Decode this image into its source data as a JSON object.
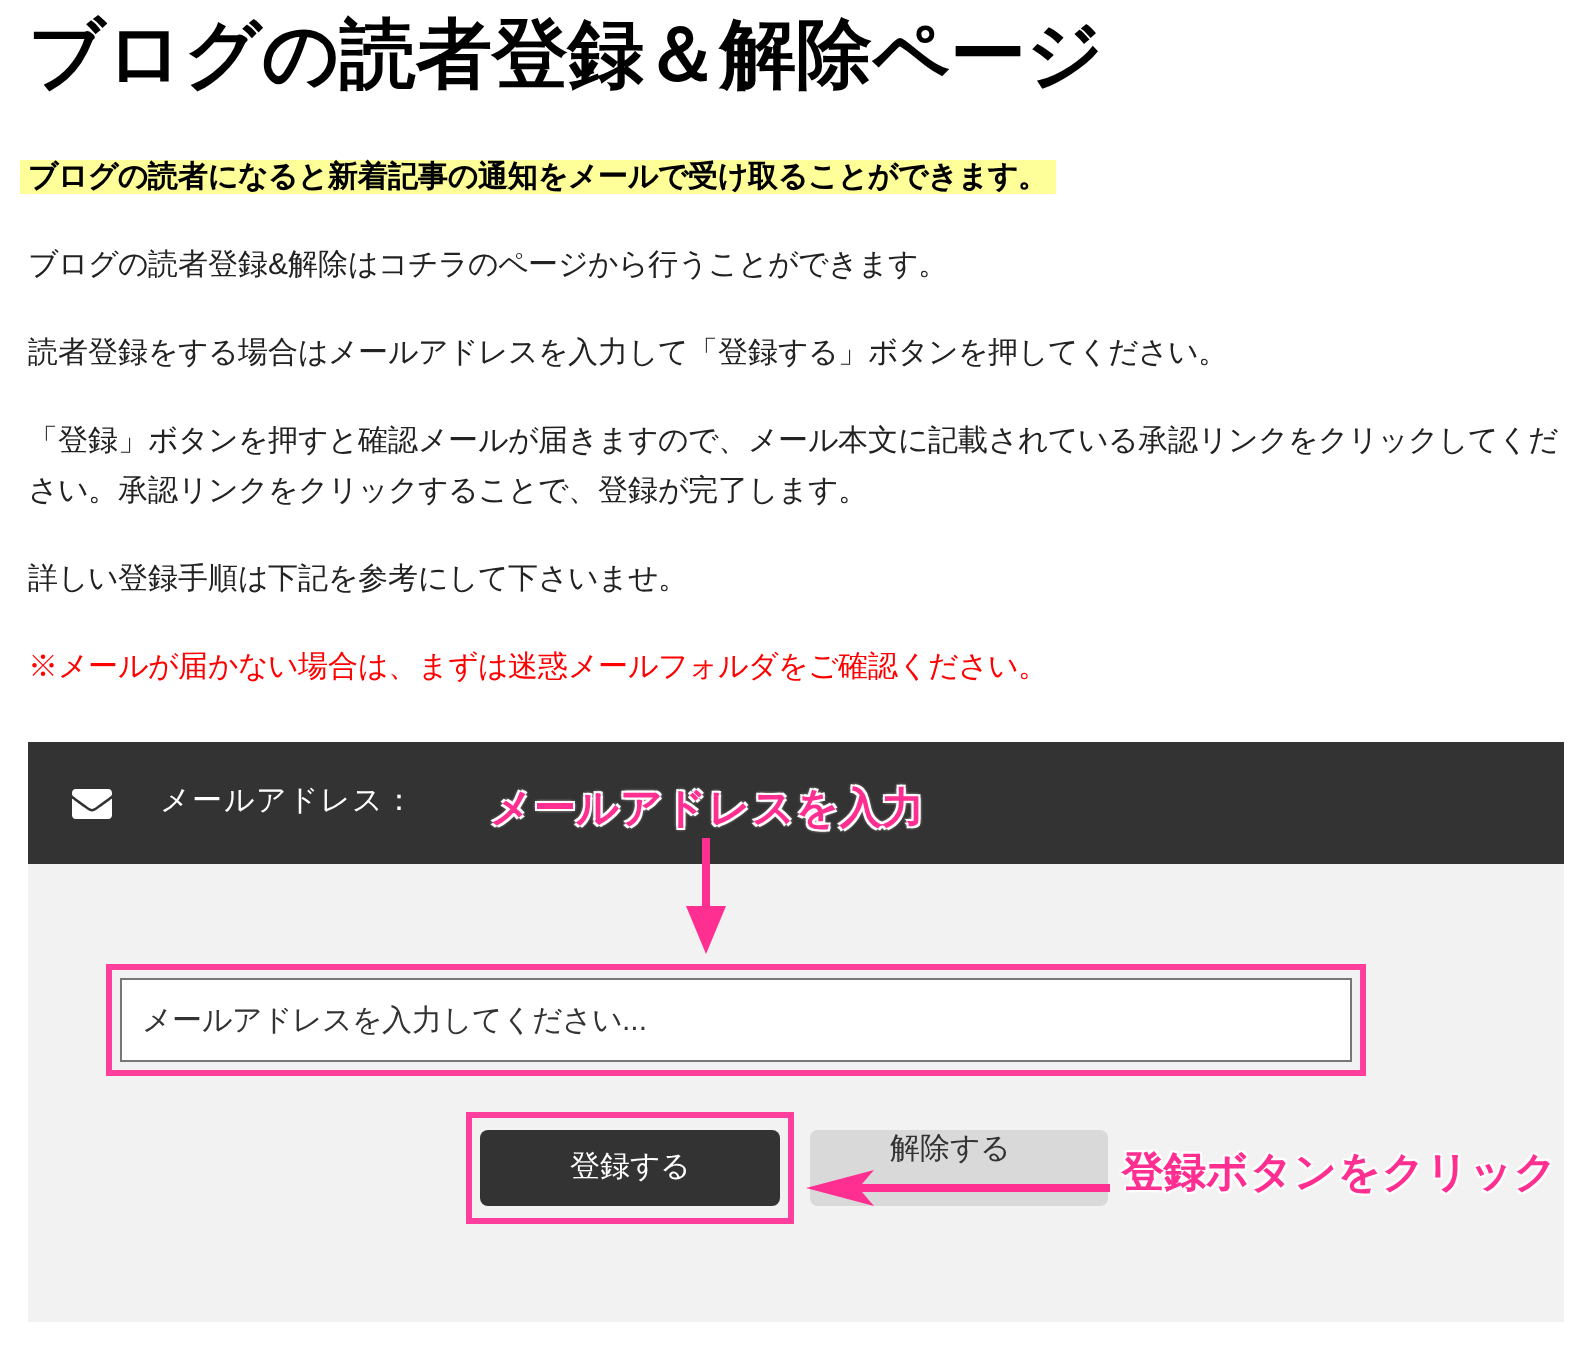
{
  "title": "ブログの読者登録＆解除ページ",
  "paragraphs": [
    {
      "kind": "highlight",
      "text": "ブログの読者になると新着記事の通知をメールで受け取ることができます。"
    },
    {
      "kind": "plain",
      "text": "ブログの読者登録&解除はコチラのページから行うことができます。"
    },
    {
      "kind": "plain",
      "text": "読者登録をする場合はメールアドレスを入力して「登録する」ボタンを押してください。"
    },
    {
      "kind": "plain",
      "text": "「登録」ボタンを押すと確認メールが届きますので、メール本文に記載されている承認リンクをクリックしてください。承認リンクをクリックすることで、登録が完了します。"
    },
    {
      "kind": "plain",
      "text": "詳しい登録手順は下記を参考にして下さいませ。"
    },
    {
      "kind": "warning",
      "text": "※メールが届かない場合は、まずは迷惑メールフォルダをご確認ください。"
    }
  ],
  "form": {
    "label": "メールアドレス：",
    "placeholder": "メールアドレスを入力してください...",
    "buttons": [
      {
        "kind": "primary",
        "label": "登録する"
      },
      {
        "kind": "secondary",
        "label": "解除する"
      }
    ]
  },
  "annotations": [
    {
      "kind": "input",
      "text": "メールアドレスを入力"
    },
    {
      "kind": "button",
      "text": "登録ボタンをクリック"
    }
  ]
}
